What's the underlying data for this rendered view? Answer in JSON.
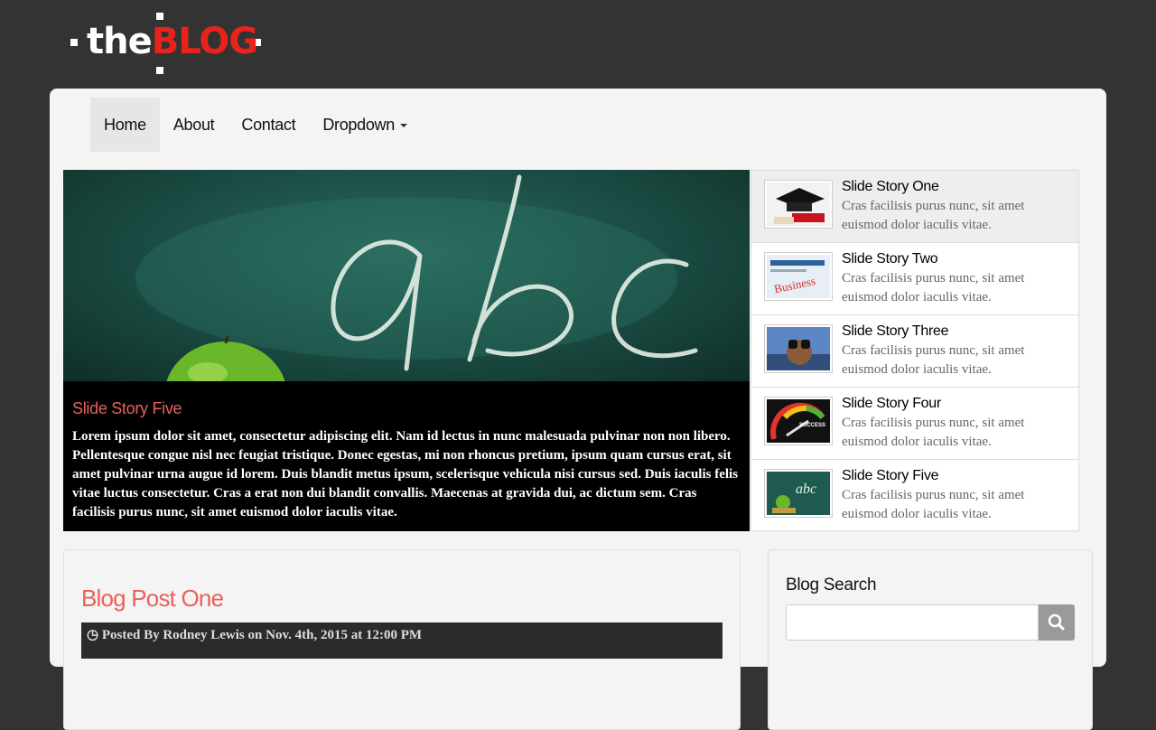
{
  "logo": {
    "part1": "the",
    "part2": "BLOG"
  },
  "nav": {
    "items": [
      {
        "label": "Home"
      },
      {
        "label": "About"
      },
      {
        "label": "Contact"
      },
      {
        "label": "Dropdown"
      }
    ]
  },
  "slider": {
    "caption_title": "Slide Story Five",
    "caption_text": "Lorem ipsum dolor sit amet, consectetur adipiscing elit. Nam id lectus in nunc malesuada pulvinar non non libero. Pellentesque congue nisl nec feugiat tristique. Donec egestas, mi non rhoncus pretium, ipsum quam cursus erat, sit amet pulvinar urna augue id lorem. Duis blandit metus ipsum, scelerisque vehicula nisi cursus sed. Duis iaculis felis vitae luctus consectetur. Cras a erat non dui blandit convallis. Maecenas at gravida dui, ac dictum sem. Cras facilisis purus nunc, sit amet euismod dolor iaculis vitae.",
    "chalk_text": "abc"
  },
  "thumbs": [
    {
      "title": "Slide Story One",
      "desc": "Cras facilisis purus nunc, sit amet euismod dolor iaculis vitae.",
      "icon": "graduation-cap-icon"
    },
    {
      "title": "Slide Story Two",
      "desc": "Cras facilisis purus nunc, sit amet euismod dolor iaculis vitae.",
      "icon": "business-newspaper-icon"
    },
    {
      "title": "Slide Story Three",
      "desc": "Cras facilisis purus nunc, sit amet euismod dolor iaculis vitae.",
      "icon": "binoculars-icon"
    },
    {
      "title": "Slide Story Four",
      "desc": "Cras facilisis purus nunc, sit amet euismod dolor iaculis vitae.",
      "icon": "success-gauge-icon"
    },
    {
      "title": "Slide Story Five",
      "desc": "Cras facilisis purus nunc, sit amet euismod dolor iaculis vitae.",
      "icon": "chalkboard-icon"
    }
  ],
  "post": {
    "title": "Blog Post One",
    "meta": "Posted By Rodney Lewis on Nov. 4th, 2015 at 12:00 PM"
  },
  "sidebar": {
    "search_title": "Blog Search",
    "search_placeholder": ""
  },
  "colors": {
    "background": "#333333",
    "accent": "#e8625a",
    "logo_red": "#e8231c"
  }
}
